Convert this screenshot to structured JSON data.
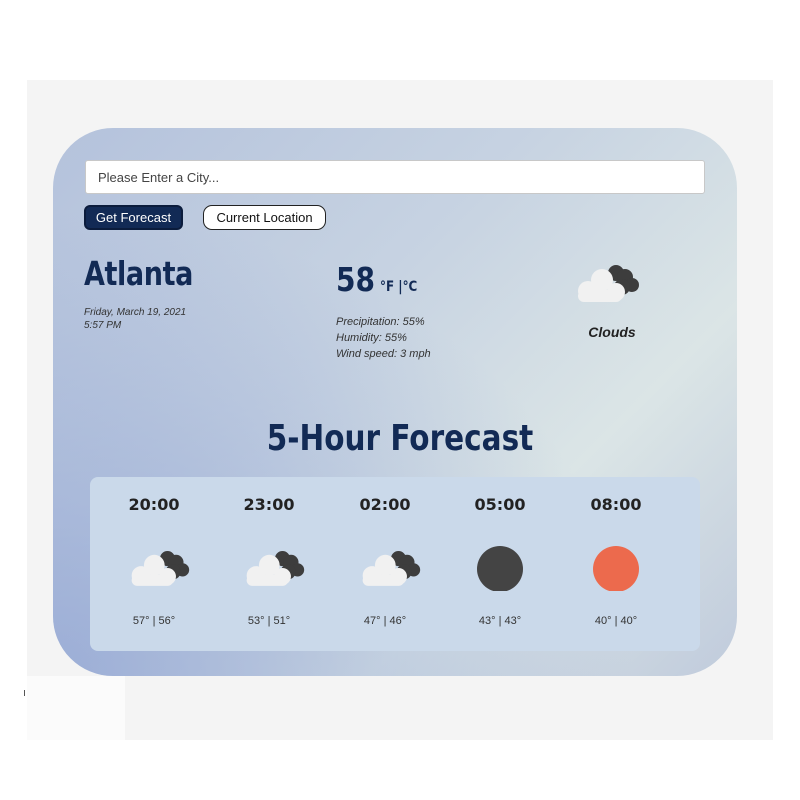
{
  "search": {
    "placeholder": "Please Enter a City..."
  },
  "buttons": {
    "get_forecast": "Get Forecast",
    "current_location": "Current Location"
  },
  "current": {
    "city": "Atlanta",
    "date": "Friday, March 19, 2021",
    "time": "5:57 PM",
    "temperature": "58",
    "units": "°F |°C",
    "precipitation": "Precipitation: 55%",
    "humidity": "Humidity: 55%",
    "wind": "Wind speed: 3 mph",
    "condition": "Clouds",
    "condition_icon": "clouds-icon"
  },
  "forecast": {
    "title": "5-Hour Forecast",
    "hours": [
      {
        "time": "20:00",
        "temps": "57° | 56°",
        "icon": "clouds-icon"
      },
      {
        "time": "23:00",
        "temps": "53° | 51°",
        "icon": "clouds-icon"
      },
      {
        "time": "02:00",
        "temps": "47° | 46°",
        "icon": "clouds-icon"
      },
      {
        "time": "05:00",
        "temps": "43° | 43°",
        "icon": "moon-icon"
      },
      {
        "time": "08:00",
        "temps": "40° | 40°",
        "icon": "sun-icon"
      }
    ]
  },
  "colors": {
    "brand_navy": "#122a55",
    "moon": "#444444",
    "sun": "#ec6a4d",
    "cloud_light": "#f1f1f1",
    "cloud_dark": "#3d3d3d"
  }
}
